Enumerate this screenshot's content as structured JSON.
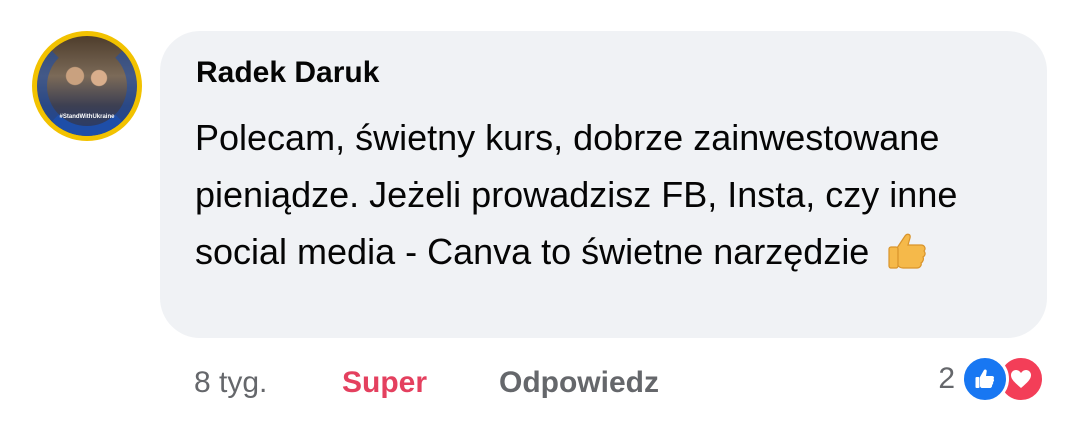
{
  "comment": {
    "author": "Radek Daruk",
    "avatar_caption": "#StandWithUkraine",
    "text": "Polecam, świetny kurs, dobrze zainwestowane pieniądze. Jeżeli prowadzisz FB, Insta, czy inne social media - Canva to świetne narzędzie",
    "emoji": "thumbs-up-emoji"
  },
  "actions": {
    "time": "8 tyg.",
    "reaction_label": "Super",
    "reply_label": "Odpowiedz"
  },
  "reactions": {
    "count": "2",
    "types": [
      "like-icon",
      "love-icon"
    ],
    "colors": {
      "like": "#1877f2",
      "love": "#f33e58",
      "super": "#e4405f"
    }
  }
}
